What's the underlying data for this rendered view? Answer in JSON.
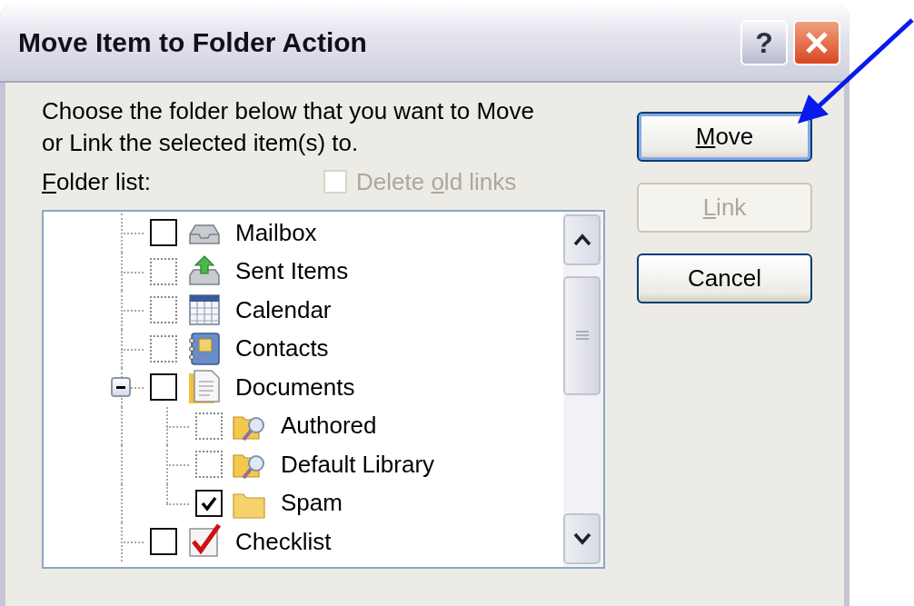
{
  "window": {
    "title": "Move Item to Folder Action",
    "title_buttons": [
      {
        "kind": "help",
        "label": "?"
      },
      {
        "kind": "close"
      }
    ]
  },
  "instruction": "Choose the folder below that you want to Move\nor Link the selected item(s) to.",
  "folder_list_label": [
    {
      "text": "F",
      "underlined": true
    },
    {
      "text": "older list:",
      "underlined": false
    }
  ],
  "delete_old_links": {
    "label": [
      {
        "text": "Delete ",
        "underlined": false
      },
      {
        "text": "o",
        "underlined": true
      },
      {
        "text": "ld links",
        "underlined": false
      }
    ],
    "checked": false,
    "disabled": true
  },
  "tree": [
    {
      "label": "Mailbox",
      "kind": "mailbox",
      "checked": false,
      "disabled": false
    },
    {
      "label": "Sent Items",
      "kind": "sent",
      "checked": false,
      "disabled": true
    },
    {
      "label": "Calendar",
      "kind": "calendar",
      "checked": false,
      "disabled": true
    },
    {
      "label": "Contacts",
      "kind": "contacts",
      "checked": false,
      "disabled": true
    },
    {
      "label": "Documents",
      "kind": "documents",
      "checked": false,
      "disabled": false,
      "expanded": true,
      "children": [
        {
          "label": "Authored",
          "kind": "search-folder",
          "checked": false,
          "disabled": true
        },
        {
          "label": "Default Library",
          "kind": "search-folder",
          "checked": false,
          "disabled": true
        },
        {
          "label": "Spam",
          "kind": "folder",
          "checked": true,
          "disabled": false
        }
      ]
    },
    {
      "label": "Checklist",
      "kind": "checklist",
      "checked": false,
      "disabled": false
    }
  ],
  "buttons": [
    {
      "label": [
        {
          "text": "M",
          "underlined": true
        },
        {
          "text": "ove",
          "underlined": false
        }
      ],
      "default": true,
      "disabled": false
    },
    {
      "label": [
        {
          "text": "L",
          "underlined": true
        },
        {
          "text": "ink",
          "underlined": false
        }
      ],
      "default": false,
      "disabled": true
    },
    {
      "label": [
        {
          "text": "Cancel",
          "underlined": false
        }
      ],
      "default": false,
      "disabled": false
    }
  ]
}
